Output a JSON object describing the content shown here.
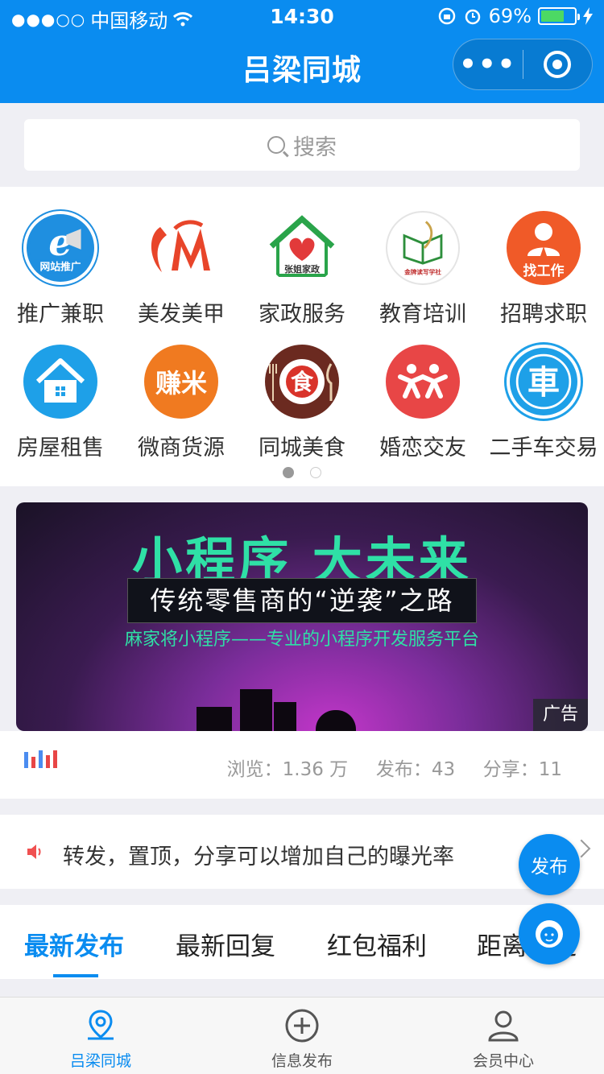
{
  "status_bar": {
    "carrier": "中国移动",
    "signal": "●●●○○",
    "time": "14:30",
    "battery": "69%",
    "battery_level": 0.69
  },
  "header": {
    "title": "吕梁同城",
    "more_label": "•••"
  },
  "search": {
    "placeholder": "搜索"
  },
  "categories": [
    {
      "label": "推广兼职",
      "icon": "website-promotion-icon",
      "badge": "网站推广",
      "color": "#1f8fe0"
    },
    {
      "label": "美发美甲",
      "icon": "hair-beauty-icon",
      "badge": "M",
      "color": "#ffffff"
    },
    {
      "label": "家政服务",
      "icon": "housekeeping-icon",
      "badge": "张姐家政",
      "color": "#ffffff"
    },
    {
      "label": "教育培训",
      "icon": "education-icon",
      "badge": "金牌读写学社",
      "color": "#ffffff"
    },
    {
      "label": "招聘求职",
      "icon": "job-search-icon",
      "badge": "找工作",
      "color": "#f05a28"
    },
    {
      "label": "房屋租售",
      "icon": "house-icon",
      "badge": "",
      "color": "#1ea0e8"
    },
    {
      "label": "微商货源",
      "icon": "zhuanmi-icon",
      "badge": "赚米",
      "color": "#f07a20"
    },
    {
      "label": "同城美食",
      "icon": "food-icon",
      "badge": "食",
      "color": "#6b2a20"
    },
    {
      "label": "婚恋交友",
      "icon": "dating-icon",
      "badge": "",
      "color": "#e84646"
    },
    {
      "label": "二手车交易",
      "icon": "used-car-icon",
      "badge": "車",
      "color": "#1ea0e8"
    }
  ],
  "pager": {
    "pages": 2,
    "active": 0
  },
  "banner": {
    "title": "小程序 大未来",
    "subtitle": "传统零售商的“逆袭”之路",
    "line": "麻家将小程序——专业的小程序开发服务平台",
    "ad_tag": "广告"
  },
  "stats": {
    "views_label": "浏览：",
    "views_value": "1.36 万",
    "posts_label": "发布：",
    "posts_value": "43",
    "shares_label": "分享：",
    "shares_value": "11"
  },
  "notice": {
    "text": "转发，置顶，分享可以增加自己的曝光率"
  },
  "tabs": [
    {
      "label": "最新发布",
      "active": true
    },
    {
      "label": "最新回复",
      "active": false
    },
    {
      "label": "红包福利",
      "active": false
    },
    {
      "label": "距离最近",
      "active": false
    }
  ],
  "fab": {
    "publish_label": "发布"
  },
  "bottom_nav": [
    {
      "label": "吕梁同城",
      "icon": "location-icon",
      "active": true
    },
    {
      "label": "信息发布",
      "icon": "plus-circle-icon",
      "active": false
    },
    {
      "label": "会员中心",
      "icon": "user-icon",
      "active": false
    }
  ],
  "colors": {
    "brand": "#0a8cf0",
    "banner_green": "#2fe0a6",
    "background": "#efeff4"
  }
}
